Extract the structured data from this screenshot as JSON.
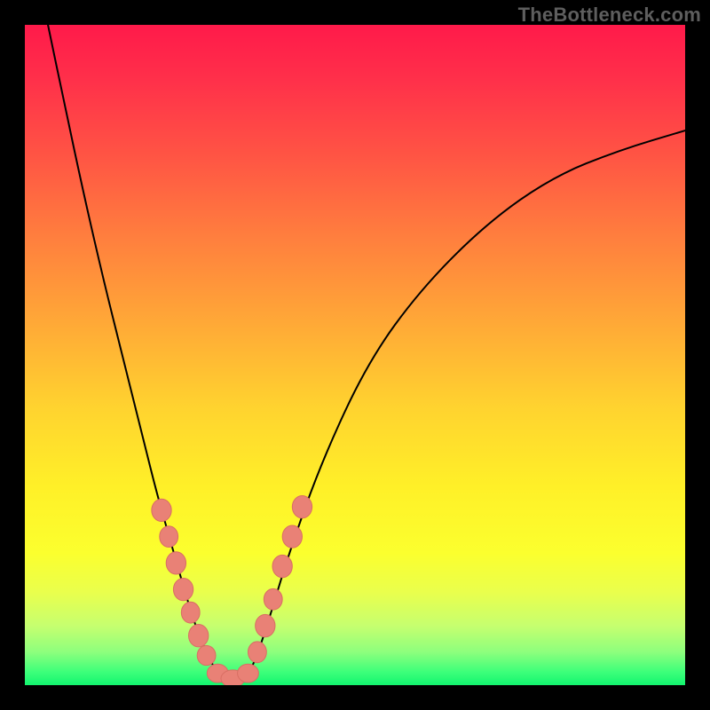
{
  "watermark": "TheBottleneck.com",
  "colors": {
    "bead_fill": "#e98176",
    "bead_stroke": "#d96e63",
    "curve_stroke": "#000000",
    "frame_bg": "#000000"
  },
  "chart_data": {
    "type": "line",
    "title": "",
    "xlabel": "",
    "ylabel": "",
    "xlim": [
      0,
      1
    ],
    "ylim": [
      0,
      1
    ],
    "series": [
      {
        "name": "left-curve",
        "x": [
          0.035,
          0.06,
          0.09,
          0.12,
          0.15,
          0.18,
          0.2,
          0.22,
          0.24,
          0.255,
          0.27,
          0.285,
          0.295
        ],
        "y": [
          1.0,
          0.88,
          0.74,
          0.61,
          0.49,
          0.37,
          0.29,
          0.22,
          0.15,
          0.1,
          0.06,
          0.03,
          0.01
        ]
      },
      {
        "name": "right-curve",
        "x": [
          0.335,
          0.35,
          0.37,
          0.4,
          0.45,
          0.52,
          0.6,
          0.7,
          0.8,
          0.9,
          1.0
        ],
        "y": [
          0.01,
          0.04,
          0.1,
          0.2,
          0.34,
          0.49,
          0.6,
          0.7,
          0.77,
          0.81,
          0.84
        ]
      }
    ],
    "beads": [
      {
        "x": 0.207,
        "y": 0.265,
        "rx": 0.015,
        "ry": 0.017
      },
      {
        "x": 0.218,
        "y": 0.225,
        "rx": 0.014,
        "ry": 0.016
      },
      {
        "x": 0.229,
        "y": 0.185,
        "rx": 0.015,
        "ry": 0.017
      },
      {
        "x": 0.24,
        "y": 0.145,
        "rx": 0.015,
        "ry": 0.017
      },
      {
        "x": 0.251,
        "y": 0.11,
        "rx": 0.014,
        "ry": 0.016
      },
      {
        "x": 0.263,
        "y": 0.075,
        "rx": 0.015,
        "ry": 0.017
      },
      {
        "x": 0.275,
        "y": 0.045,
        "rx": 0.014,
        "ry": 0.015
      },
      {
        "x": 0.292,
        "y": 0.018,
        "rx": 0.016,
        "ry": 0.014
      },
      {
        "x": 0.315,
        "y": 0.01,
        "rx": 0.018,
        "ry": 0.013
      },
      {
        "x": 0.338,
        "y": 0.018,
        "rx": 0.016,
        "ry": 0.014
      },
      {
        "x": 0.352,
        "y": 0.05,
        "rx": 0.014,
        "ry": 0.016
      },
      {
        "x": 0.364,
        "y": 0.09,
        "rx": 0.015,
        "ry": 0.017
      },
      {
        "x": 0.376,
        "y": 0.13,
        "rx": 0.014,
        "ry": 0.016
      },
      {
        "x": 0.39,
        "y": 0.18,
        "rx": 0.015,
        "ry": 0.017
      },
      {
        "x": 0.405,
        "y": 0.225,
        "rx": 0.015,
        "ry": 0.017
      },
      {
        "x": 0.42,
        "y": 0.27,
        "rx": 0.015,
        "ry": 0.017
      }
    ],
    "valley_x": 0.315
  }
}
